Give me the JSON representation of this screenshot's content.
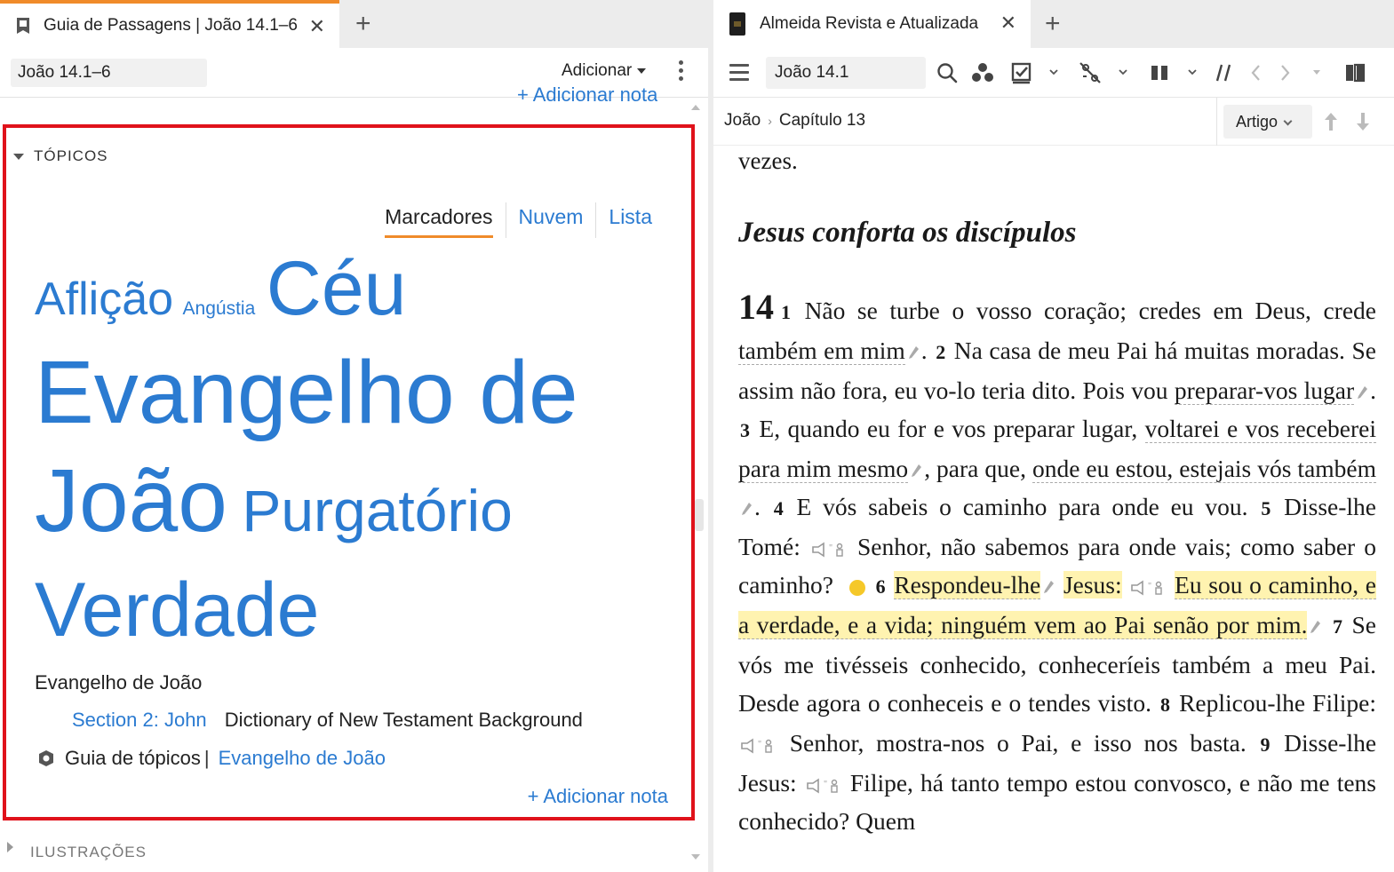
{
  "left": {
    "tab_title": "Guia de Passagens | João 14.1–6",
    "reference": "João 14.1–6",
    "add_menu": "Adicionar",
    "peek_note": "+ Adicionar nota",
    "topics": {
      "heading": "TÓPICOS",
      "view_tabs": [
        "Marcadores",
        "Nuvem",
        "Lista"
      ],
      "cloud": [
        "Aflição",
        "Angústia",
        "Céu",
        "Evangelho de",
        "João",
        "Purgatório",
        "Verdade"
      ],
      "selected_topic": "Evangelho de João",
      "ref_link": "Section 2: John",
      "ref_source": "Dictionary of New Testament Background",
      "guide_label": "Guia de tópicos",
      "guide_sep": "|",
      "guide_link": "Evangelho de João",
      "add_note": "+ Adicionar nota"
    },
    "illustrations_heading": "ILUSTRAÇÕES"
  },
  "right": {
    "tab_title": "Almeida Revista e Atualizada",
    "reference": "João 14.1",
    "breadcrumb": [
      "João",
      "Capítulo 13"
    ],
    "view_mode": "Artigo",
    "prev_text": "vezes.",
    "heading": "Jesus conforta os discípulos",
    "chapter": "14",
    "v1_num": "1",
    "v1a": "Não se turbe o vosso coração; credes em Deus, crede",
    "v1b": "também em mim",
    "v2_num": "2",
    "v2a": "Na casa de meu Pai há muitas moradas. Se assim não fora, eu vo-lo teria dito. Pois vou",
    "v2b": "preparar-vos lugar",
    "v3_num": "3",
    "v3a": "E, quando eu for e vos preparar lugar,",
    "v3b": "voltarei e vos receberei para mim mesmo",
    "v3c": ", para que,",
    "v3d": "onde eu estou, estejais vós também",
    "v4_num": "4",
    "v4": "E vós sabeis o caminho para onde eu vou.",
    "v5_num": "5",
    "v5a": "Disse-lhe Tomé:",
    "v5b": "Senhor, não sabemos para onde vais; como saber o caminho?",
    "v6_num": "6",
    "v6a": "Respondeu-lhe",
    "v6b": "Jesus:",
    "v6c": "Eu sou o caminho, e a verdade, e a vida; ninguém vem ao Pai senão por mim.",
    "v7_num": "7",
    "v7": "Se vós me tivésseis conhecido, conheceríeis também a meu Pai. Desde agora o conheceis e o tendes visto.",
    "v8_num": "8",
    "v8a": "Replicou-lhe Filipe:",
    "v8b": "Senhor, mostra-nos o Pai, e isso nos basta.",
    "v9_num": "9",
    "v9a": "Disse-lhe Jesus:",
    "v9b": "Filipe, há tanto tempo estou convosco, e não me tens conhecido? Quem"
  },
  "colors": {
    "accent": "#f08b2a",
    "link": "#2b7bd1",
    "highlight": "#fff3b0",
    "selection_border": "#e0121b"
  }
}
